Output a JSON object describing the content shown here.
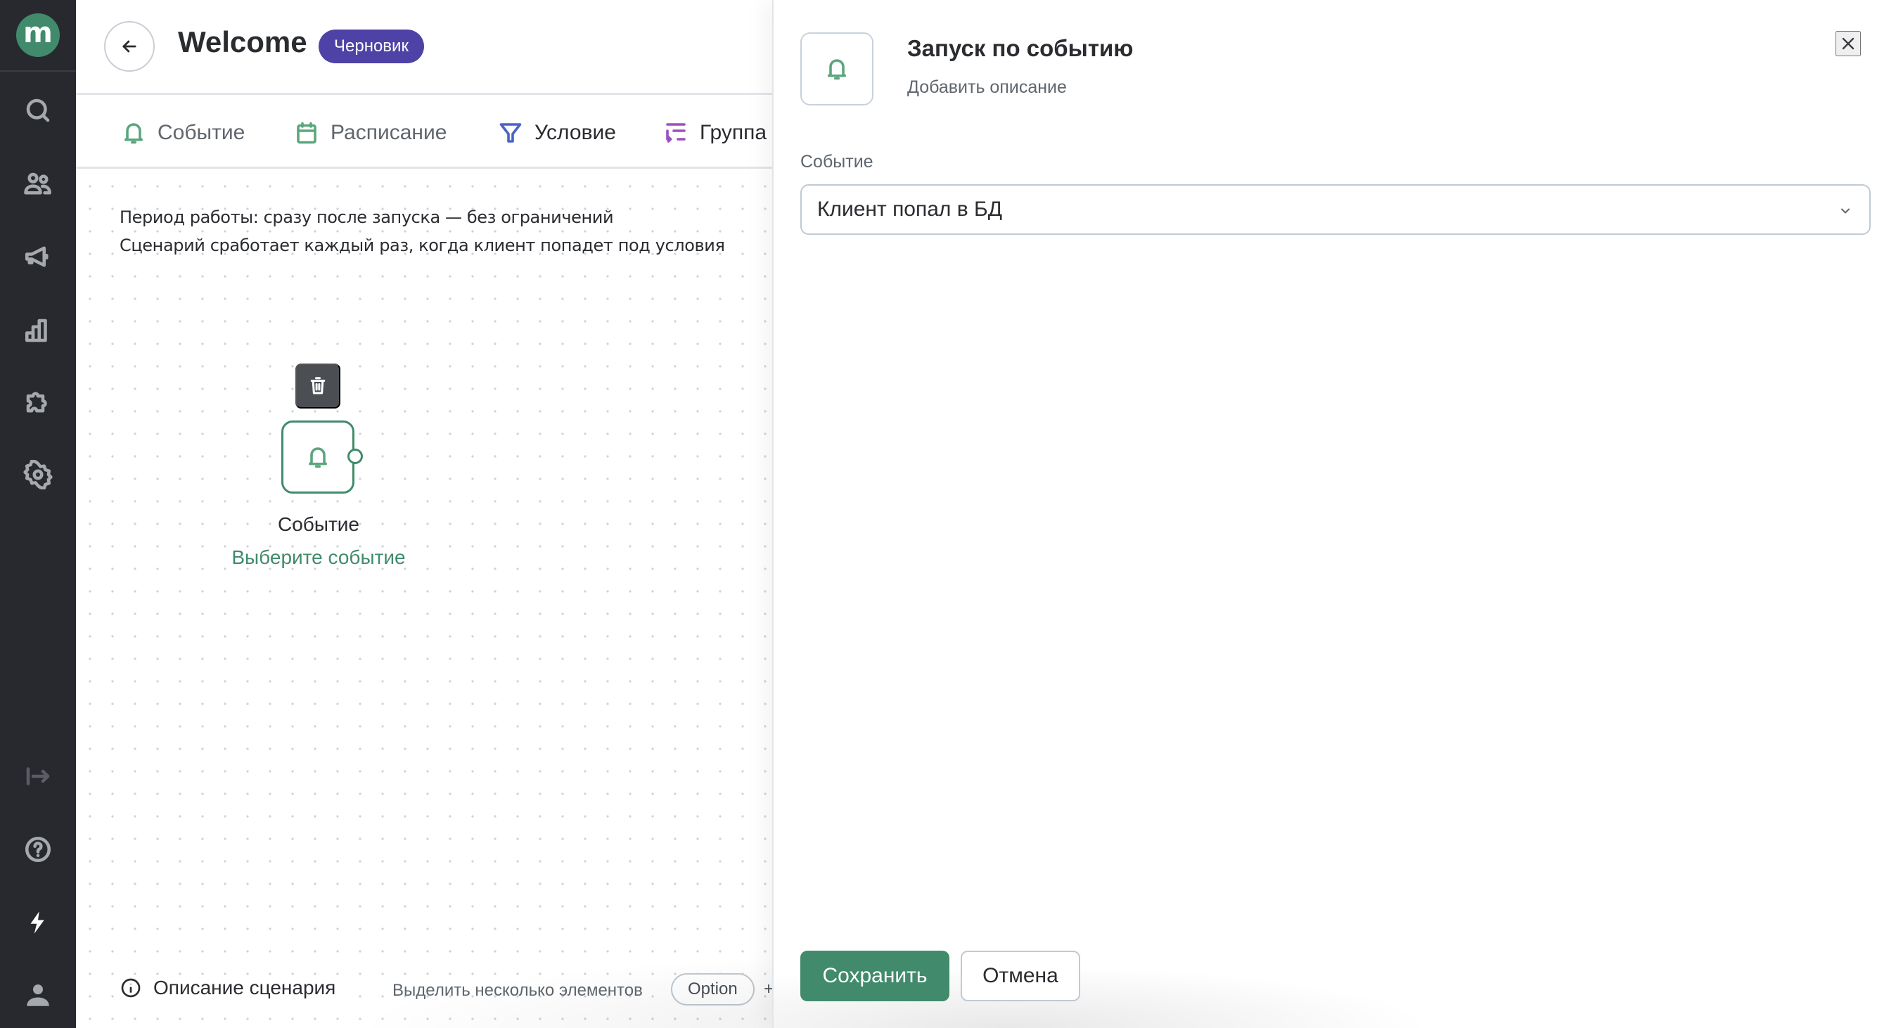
{
  "sidebar": {
    "logo_letter": "m",
    "items": [
      {
        "name": "search",
        "icon": "search-icon"
      },
      {
        "name": "clients",
        "icon": "users-icon"
      },
      {
        "name": "campaigns",
        "icon": "megaphone-icon"
      },
      {
        "name": "analytics",
        "icon": "bar-chart-icon"
      },
      {
        "name": "integrations",
        "icon": "puzzle-icon"
      },
      {
        "name": "settings",
        "icon": "gear-icon"
      }
    ],
    "bottom_items": [
      {
        "name": "expand",
        "icon": "expand-arrow-icon"
      },
      {
        "name": "help",
        "icon": "help-icon"
      },
      {
        "name": "updates",
        "icon": "lightning-icon"
      },
      {
        "name": "profile",
        "icon": "user-icon"
      }
    ]
  },
  "header": {
    "title": "Welcome",
    "status_badge": "Черновик",
    "badge_color": "#4f42a6"
  },
  "toolbar": {
    "tabs": [
      {
        "label": "Событие",
        "icon": "bell-icon",
        "color": "#5ba67d"
      },
      {
        "label": "Расписание",
        "icon": "calendar-icon",
        "color": "#5ba67d"
      },
      {
        "label": "Условие",
        "icon": "filter-icon",
        "color": "#4a63c7"
      },
      {
        "label": "Группа",
        "icon": "group-icon",
        "color": "#9b4fc1"
      }
    ]
  },
  "canvas": {
    "info_lines": [
      "Период работы: сразу после запуска — без ограничений",
      "Сценарий сработает каждый раз, когда клиент попадет под условия"
    ],
    "node": {
      "title": "Событие",
      "subtitle": "Выберите событие",
      "icon": "bell-icon"
    },
    "footer": {
      "description_link": "Описание сценария",
      "hint": "Выделить несколько элементов",
      "key": "Option",
      "plus": "+"
    }
  },
  "panel": {
    "title": "Запуск по событию",
    "description_placeholder": "Добавить описание",
    "field_label": "Событие",
    "selected_event": "Клиент попал в БД",
    "save_label": "Сохранить",
    "cancel_label": "Отмена"
  },
  "colors": {
    "brand_green": "#418b6c",
    "sidebar_bg": "#27292e"
  }
}
